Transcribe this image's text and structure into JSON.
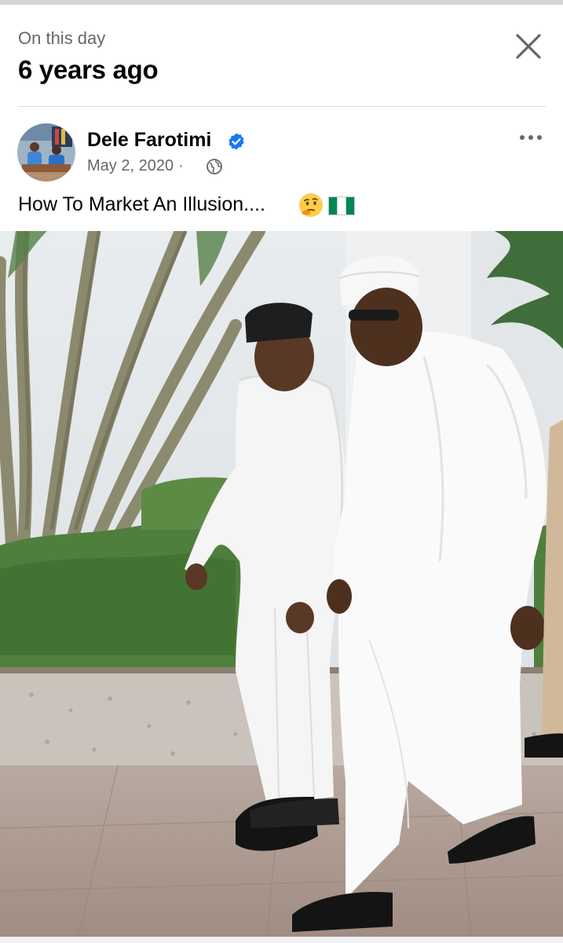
{
  "header": {
    "subtitle": "On this day",
    "title": "6 years ago",
    "close_icon": "close-icon"
  },
  "post": {
    "author": "Dele Farotimi",
    "verified_icon": "verified-badge-icon",
    "date": "May 2, 2020",
    "separator": "·",
    "audience_icon": "globe-icon",
    "more_icon": "more-horizontal-icon",
    "caption": "How To Market An Illusion....",
    "caption_emojis": [
      "thinking-face-emoji",
      "nigeria-flag-emoji"
    ],
    "accent_color": "#1877f2"
  }
}
